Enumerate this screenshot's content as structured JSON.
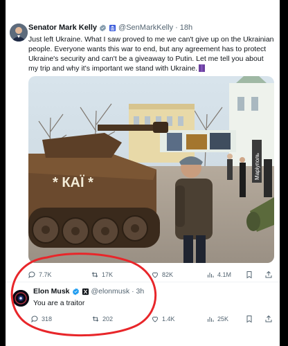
{
  "tweet1": {
    "author_name": "Senator Mark Kelly",
    "handle": "@SenMarkKelly",
    "time": "· 18h",
    "text": "Just left Ukraine. What I saw proved to me we can't give up on the Ukrainian people. Everyone wants this war to end, but any agreement has to protect Ukraine's security and can't be a giveaway to Putin. Let me tell you about my trip and why it's important we stand with Ukraine.",
    "photo_sign": "Марiуполь",
    "photo_tank_text": "* КАЇ *",
    "metrics": {
      "replies": "7.7K",
      "reposts": "17K",
      "likes": "82K",
      "views": "4.1M"
    }
  },
  "tweet2": {
    "author_name": "Elon Musk",
    "handle": "@elonmusk",
    "time": "· 3h",
    "text": "You are a traitor",
    "metrics": {
      "replies": "318",
      "reposts": "202",
      "likes": "1.4K",
      "views": "25K"
    }
  },
  "colors": {
    "verified": "#1d9bf0",
    "secondary_text": "#536471",
    "annotation": "#e8262a",
    "gov_badge": "#829aab"
  },
  "icons": [
    "reply-icon",
    "repost-icon",
    "like-icon",
    "views-icon",
    "bookmark-icon",
    "share-icon",
    "verified-badge-icon",
    "government-badge-icon",
    "x-affiliate-badge-icon",
    "purple-ribbon-icon"
  ]
}
